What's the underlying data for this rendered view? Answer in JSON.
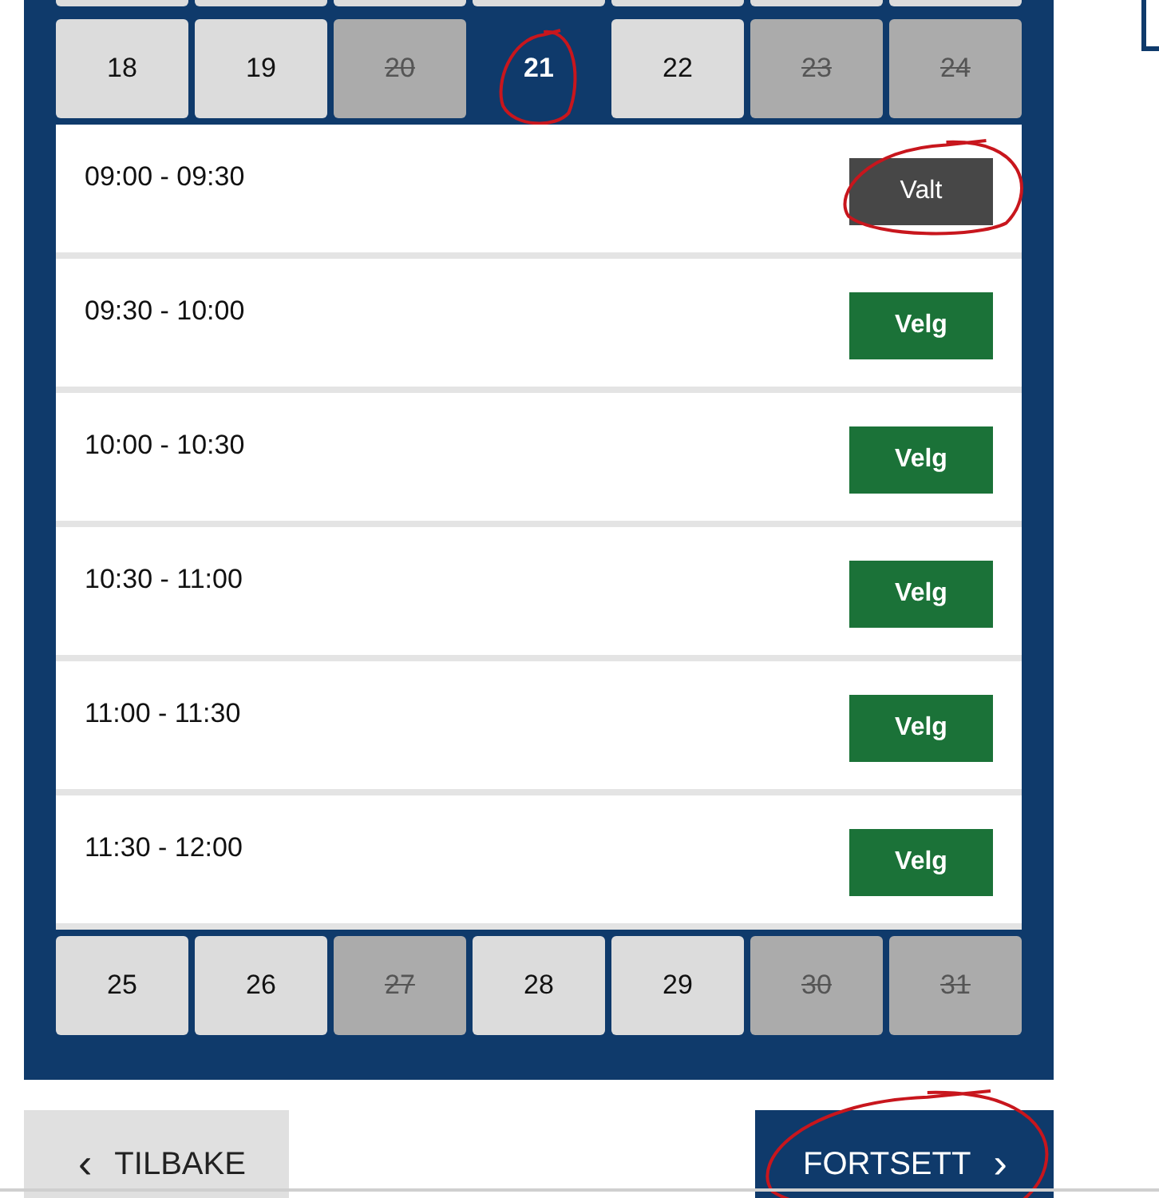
{
  "weeks": [
    {
      "days": [
        {
          "label": "18",
          "available": true,
          "selected": false,
          "circled": false
        },
        {
          "label": "19",
          "available": true,
          "selected": false,
          "circled": false
        },
        {
          "label": "20",
          "available": false,
          "selected": false,
          "circled": false
        },
        {
          "label": "21",
          "available": true,
          "selected": true,
          "circled": true
        },
        {
          "label": "22",
          "available": true,
          "selected": false,
          "circled": false
        },
        {
          "label": "23",
          "available": false,
          "selected": false,
          "circled": false
        },
        {
          "label": "24",
          "available": false,
          "selected": false,
          "circled": false
        }
      ],
      "slots": [
        {
          "time": "09:00 - 09:30",
          "button": "Valt",
          "selected": true,
          "circled": true
        },
        {
          "time": "09:30 - 10:00",
          "button": "Velg",
          "selected": false,
          "circled": false
        },
        {
          "time": "10:00 - 10:30",
          "button": "Velg",
          "selected": false,
          "circled": false
        },
        {
          "time": "10:30 - 11:00",
          "button": "Velg",
          "selected": false,
          "circled": false
        },
        {
          "time": "11:00 - 11:30",
          "button": "Velg",
          "selected": false,
          "circled": false
        },
        {
          "time": "11:30 - 12:00",
          "button": "Velg",
          "selected": false,
          "circled": false
        }
      ]
    },
    {
      "days": [
        {
          "label": "25",
          "available": true,
          "selected": false,
          "circled": false
        },
        {
          "label": "26",
          "available": true,
          "selected": false,
          "circled": false
        },
        {
          "label": "27",
          "available": false,
          "selected": false,
          "circled": false
        },
        {
          "label": "28",
          "available": true,
          "selected": false,
          "circled": false
        },
        {
          "label": "29",
          "available": true,
          "selected": false,
          "circled": false
        },
        {
          "label": "30",
          "available": false,
          "selected": false,
          "circled": false
        },
        {
          "label": "31",
          "available": false,
          "selected": false,
          "circled": false
        }
      ]
    }
  ],
  "back": {
    "label": "TILBAKE",
    "icon": "‹"
  },
  "next": {
    "label": "FORTSETT",
    "icon": "›",
    "circled": true
  }
}
